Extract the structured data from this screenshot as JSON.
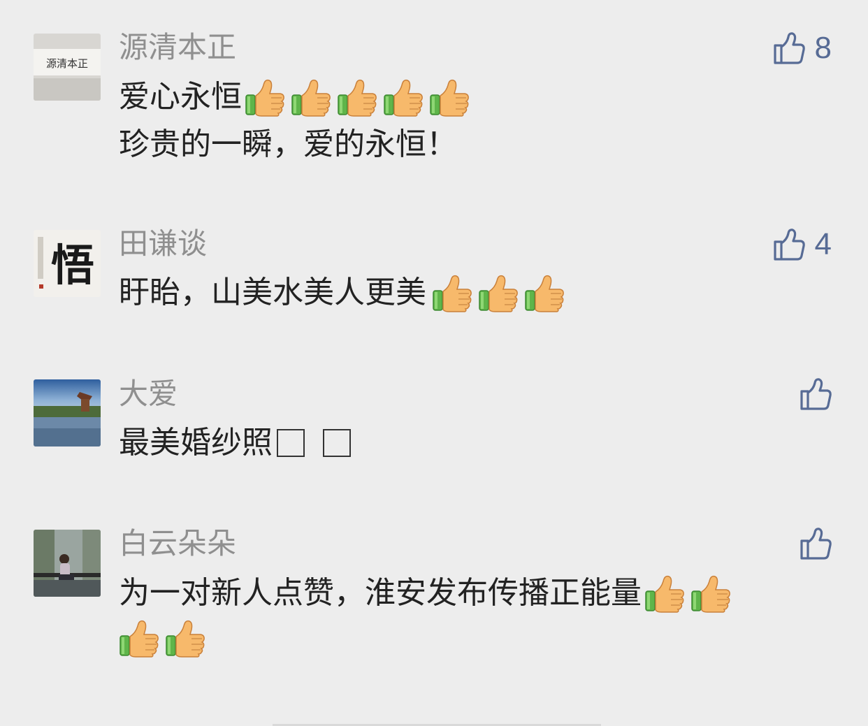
{
  "comments": [
    {
      "name": "源清本正",
      "lines": [
        "爱心永恒",
        "珍贵的一瞬，爱的永恒！"
      ],
      "line1_emoji": 5,
      "likes": "8",
      "avatar_text": "源清本正"
    },
    {
      "name": "田谦谈",
      "lines": [
        "盱眙，山美水美人更美"
      ],
      "line1_emoji": 3,
      "likes": "4",
      "avatar_text": "悟"
    },
    {
      "name": "大爱",
      "lines": [
        "最美婚纱照"
      ],
      "likes": ""
    },
    {
      "name": "白云朵朵",
      "lines": [
        "为一对新人点赞，淮安发布传播正能量"
      ],
      "line1_emoji": 2,
      "line2_emoji": 2,
      "likes": ""
    }
  ],
  "colors": {
    "background": "#ededed",
    "name": "#8f8f8f",
    "text": "#222222",
    "like": "#576b95"
  },
  "icons": [
    "thumbs-up-emoji",
    "like-icon"
  ]
}
